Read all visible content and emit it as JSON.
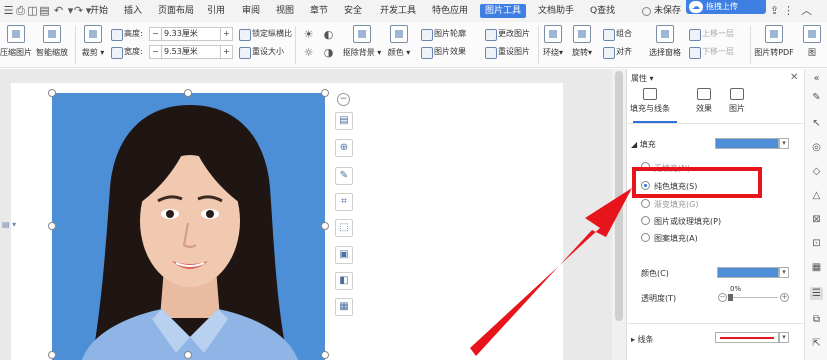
{
  "menubar": {
    "file_label": "三",
    "tabs": [
      "开始",
      "插入",
      "页面布局",
      "引用",
      "审阅",
      "视图",
      "章节",
      "安全",
      "开发工具",
      "特色应用",
      "图片工具",
      "文档助手"
    ],
    "active_tab": "图片工具",
    "search_label": "Q查找",
    "save_status": "未保存",
    "upload_badge": "拖拽上传"
  },
  "ribbon": {
    "compress_label": "压缩图片",
    "smart_zoom_label": "智能缩放",
    "crop_label": "裁剪",
    "height_label": "高度:",
    "height_value": "9.33厘米",
    "width_label": "宽度:",
    "width_value": "9.53厘米",
    "lock_ratio_label": "锁定纵横比",
    "reset_size_label": "重设大小",
    "remove_bg_label": "抠除背景",
    "color_label": "颜色",
    "outline_label": "图片轮廓",
    "effects_label": "图片效果",
    "change_pic_label": "更改图片",
    "reset_pic_label": "重设图片",
    "wrap_label": "环绕",
    "rotate_label": "旋转",
    "group_label": "组合",
    "align_label": "对齐",
    "select_pane_label": "选择窗格",
    "bring_forward_label": "上移一层",
    "send_backward_label": "下移一层",
    "to_pdf_label": "图片转PDF",
    "pic_label": "图"
  },
  "pane": {
    "title": "属性",
    "tabs": [
      "填充与线条",
      "效果",
      "图片"
    ],
    "fill_heading": "填充",
    "options": [
      "无填充(N)",
      "纯色填充(S)",
      "渐变填充(G)",
      "图片或纹理填充(P)",
      "图案填充(A)"
    ],
    "selected_option": "纯色填充(S)",
    "color_label": "颜色(C)",
    "transparency_label": "透明度(T)",
    "transparency_value": "0%",
    "line_heading": "线条",
    "accent_color": "#2e6fd8",
    "fill_color": "#4c8fd6",
    "annotation_color": "#e8141b"
  }
}
